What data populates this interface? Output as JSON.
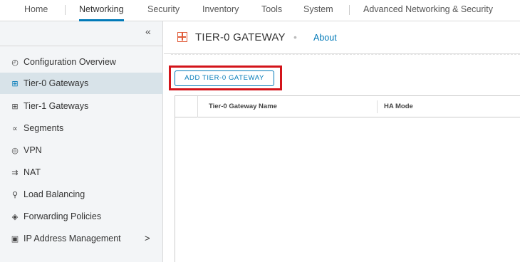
{
  "topnav": {
    "tabs": [
      {
        "label": "Home"
      },
      {
        "label": "Networking"
      },
      {
        "label": "Security"
      },
      {
        "label": "Inventory"
      },
      {
        "label": "Tools"
      },
      {
        "label": "System"
      },
      {
        "label": "Advanced Networking & Security"
      }
    ],
    "active_tab": "Networking"
  },
  "sidebar": {
    "collapse_glyph": "«",
    "items": [
      {
        "label": "Configuration Overview",
        "icon": "gauge-icon"
      },
      {
        "label": "Tier-0 Gateways",
        "icon": "gateway-icon"
      },
      {
        "label": "Tier-1 Gateways",
        "icon": "gateway-icon"
      },
      {
        "label": "Segments",
        "icon": "segments-icon"
      },
      {
        "label": "VPN",
        "icon": "vpn-icon"
      },
      {
        "label": "NAT",
        "icon": "nat-icon"
      },
      {
        "label": "Load Balancing",
        "icon": "load-balancer-icon"
      },
      {
        "label": "Forwarding Policies",
        "icon": "forwarding-icon"
      },
      {
        "label": "IP Address Management",
        "icon": "ip-management-icon"
      }
    ],
    "selected": "Tier-0 Gateways",
    "expand_glyph": ">"
  },
  "main": {
    "title": "TIER-0 GATEWAY",
    "separator": "•",
    "about_link": "About",
    "add_button": "ADD TIER-0 GATEWAY",
    "table": {
      "columns": [
        "Tier-0 Gateway Name",
        "HA Mode"
      ],
      "rows": []
    }
  },
  "colors": {
    "accent": "#0079b8",
    "highlight_box": "#d3141a",
    "title_icon": "#e05c3a",
    "sidebar_bg": "#f3f5f7",
    "sidebar_selected": "#d8e3e9"
  }
}
